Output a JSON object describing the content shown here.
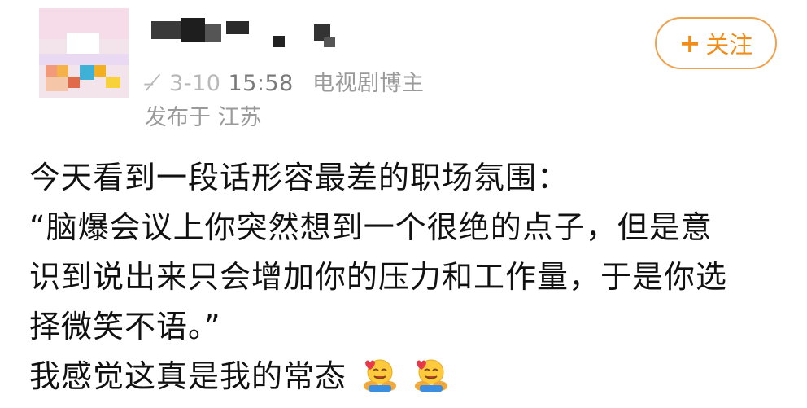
{
  "post": {
    "username_obscured": "",
    "meta": {
      "date_partial": "– ̸ 3-10",
      "time": "15:58",
      "author_tag": "电视剧博主",
      "location": "发布于 江苏"
    },
    "follow_button": {
      "icon": "plus-icon",
      "label": "关注",
      "plus": "+"
    },
    "content_lines": [
      "今天看到一段话形容最差的职场氛围：",
      "“脑爆会议上你突然想到一个很绝的点子，但是意",
      "识到说出来只会增加你的压力和工作量，于是你选",
      "择微笑不语。”",
      "我感觉这真是我的常态"
    ],
    "emojis": [
      "hugging-face-icon",
      "hugging-face-icon"
    ]
  },
  "colors": {
    "accent": "#f08c1a",
    "accent_border": "#f0a14e",
    "meta_text": "#9a9a9a",
    "body_text": "#111111"
  }
}
